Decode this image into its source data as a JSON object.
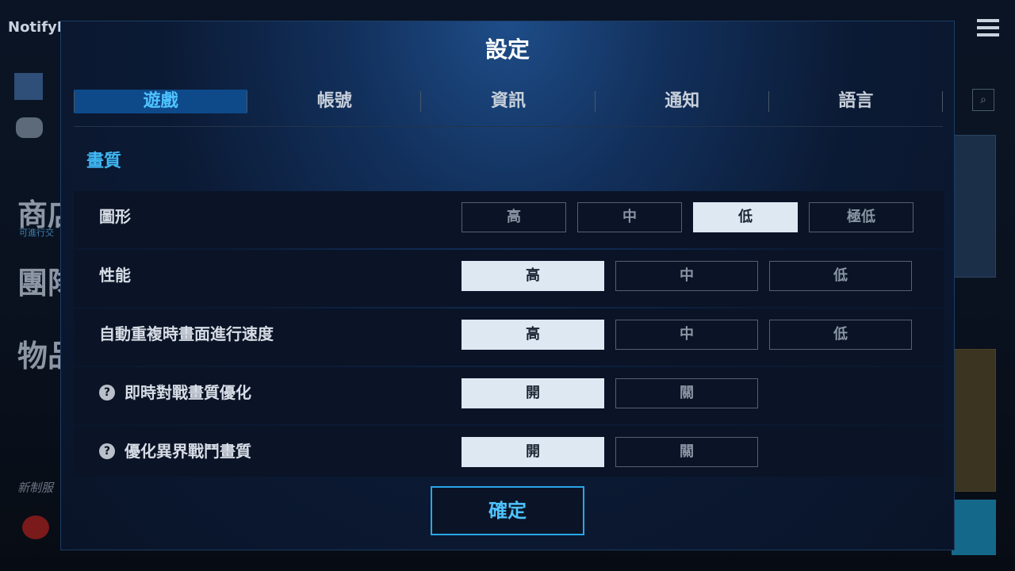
{
  "background": {
    "app_label": "NotifyB",
    "left_labels": [
      "商店",
      "團隊",
      "物品"
    ],
    "left_sub": "可進行交",
    "left_italic": "新制服"
  },
  "dialog": {
    "title": "設定",
    "tabs": [
      {
        "label": "遊戲",
        "active": true
      },
      {
        "label": "帳號",
        "active": false
      },
      {
        "label": "資訊",
        "active": false
      },
      {
        "label": "通知",
        "active": false
      },
      {
        "label": "語言",
        "active": false
      }
    ],
    "section_title": "畫質",
    "rows": [
      {
        "label": "圖形",
        "help": false,
        "options": [
          "高",
          "中",
          "低",
          "極低"
        ],
        "selected": 2
      },
      {
        "label": "性能",
        "help": false,
        "options": [
          "高",
          "中",
          "低"
        ],
        "selected": 0
      },
      {
        "label": "自動重複時畫面進行速度",
        "help": false,
        "options": [
          "高",
          "中",
          "低"
        ],
        "selected": 0
      },
      {
        "label": "即時對戰畫質優化",
        "help": true,
        "options": [
          "開",
          "關"
        ],
        "selected": 0
      },
      {
        "label": "優化異界戰鬥畫質",
        "help": true,
        "options": [
          "開",
          "關"
        ],
        "selected": 0
      }
    ],
    "help_glyph": "?",
    "confirm_label": "確定"
  },
  "colors": {
    "accent": "#3fb8f5",
    "selected_option_bg": "#dde8f2",
    "active_tab_bg": "#0e4a8a"
  }
}
